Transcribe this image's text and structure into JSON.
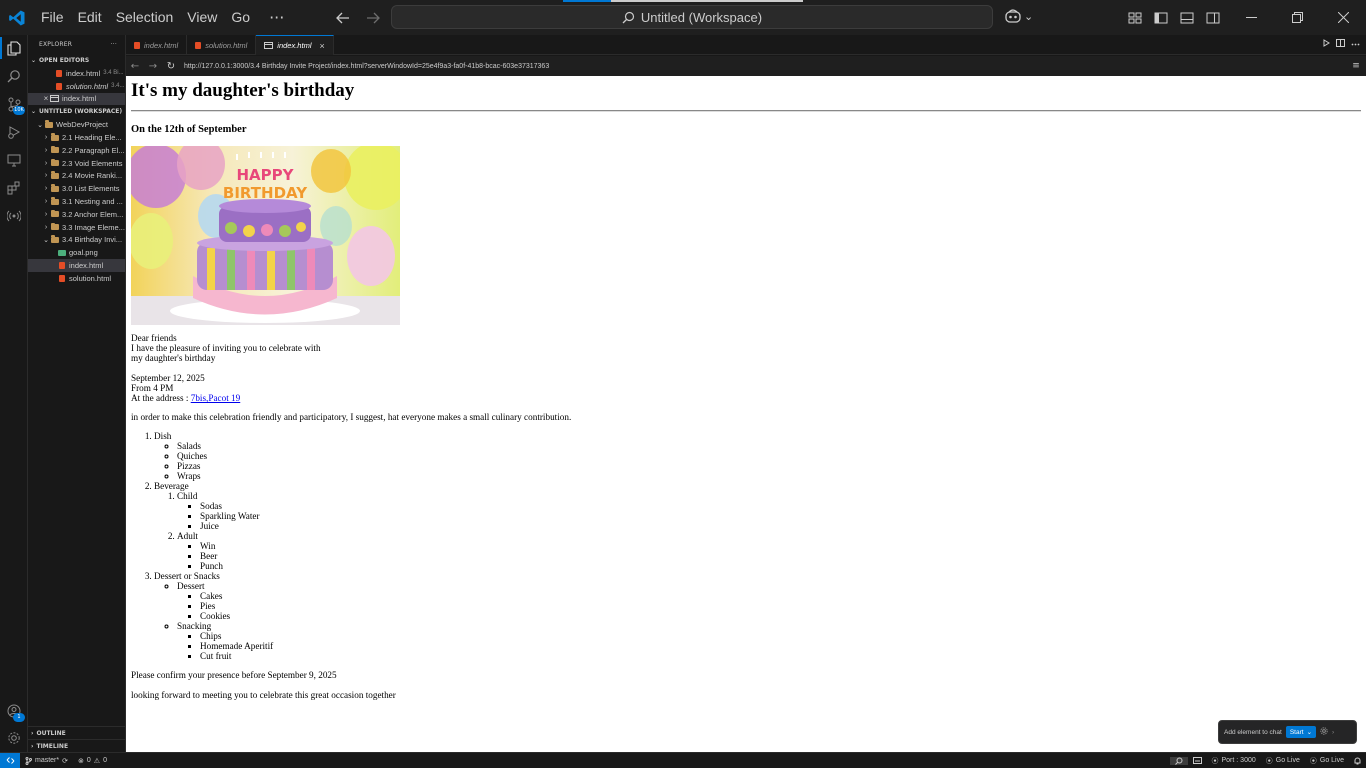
{
  "titlebar": {
    "menu": [
      "File",
      "Edit",
      "Selection",
      "View",
      "Go"
    ],
    "more": "···",
    "command_center": "Untitled (Workspace)"
  },
  "sidebar": {
    "title": "EXPLORER",
    "more": "···",
    "open_editors_label": "OPEN EDITORS",
    "open_editors": [
      {
        "name": "index.html",
        "desc": "3.4 Bi..."
      },
      {
        "name": "solution.html",
        "desc": "3.4..."
      },
      {
        "name": "index.html",
        "desc": ""
      }
    ],
    "workspace_label": "UNTITLED (WORKSPACE)",
    "root_folder": "WebDevProject",
    "folders": [
      "2.1 Heading Ele...",
      "2.2 Paragraph El...",
      "2.3 Void Elements",
      "2.4 Movie Ranki...",
      "3.0 List Elements",
      "3.1 Nesting and ...",
      "3.2 Anchor Elem...",
      "3.3 Image Eleme...",
      "3.4 Birthday Invi..."
    ],
    "files": [
      "goal.png",
      "index.html",
      "solution.html"
    ],
    "outline_label": "OUTLINE",
    "timeline_label": "TIMELINE",
    "scm_badge": "10K",
    "account_badge": "1"
  },
  "tabs": [
    {
      "label": "index.html",
      "active": false
    },
    {
      "label": "solution.html",
      "active": false
    },
    {
      "label": "index.html",
      "active": true
    }
  ],
  "tab_close": "×",
  "browser": {
    "url": "http://127.0.0.1:3000/3.4 Birthday Invite Project/index.html?serverWindowId=25e4f9a3-fa0f-41b8-bcac-603e37317363"
  },
  "page": {
    "heading": "It's my daughter's birthday",
    "subheading": "On the 12th of September",
    "cake_text": "HAPPY BIRTHDAY",
    "intro": [
      "Dear friends",
      "I have the pleasure of inviting you to celebrate with",
      "my daughter's birthday"
    ],
    "details": [
      "September 12, 2025",
      "From 4 PM"
    ],
    "address_label": "At the address : ",
    "address_link": "7bis,Pacot 19",
    "contribution": "in order to make this celebration friendly and participatory, I suggest, hat everyone makes a small culinary contribution.",
    "dish": {
      "label": "Dish",
      "items": [
        "Salads",
        "Quiches",
        "Pizzas",
        "Wraps"
      ]
    },
    "beverage": {
      "label": "Beverage",
      "child": {
        "label": "Child",
        "items": [
          "Sodas",
          "Sparkling Water",
          "Juice"
        ]
      },
      "adult": {
        "label": "Adult",
        "items": [
          "Win",
          "Beer",
          "Punch"
        ]
      }
    },
    "dessert": {
      "label": "Dessert or Snacks",
      "dessert": {
        "label": "Dessert",
        "items": [
          "Cakes",
          "Pies",
          "Cookies"
        ]
      },
      "snacking": {
        "label": "Snacking",
        "items": [
          "Chips",
          "Homemade Aperitif",
          "Cut fruit"
        ]
      }
    },
    "confirm": "Please confirm your presence before September 9, 2025",
    "closing": "looking forward to meeting you to celebrate this great occasion together"
  },
  "chat_pill": {
    "label": "Add element to chat",
    "start": "Start"
  },
  "statusbar": {
    "branch": "master*",
    "problems": "0",
    "warnings": "0",
    "port": "Port : 3000",
    "go_live_1": "Go Live",
    "go_live_2": "Go Live"
  },
  "colors": {
    "accent": "#0078d4",
    "link": "#0000ee",
    "editor_bg": "#1f1f1f"
  }
}
